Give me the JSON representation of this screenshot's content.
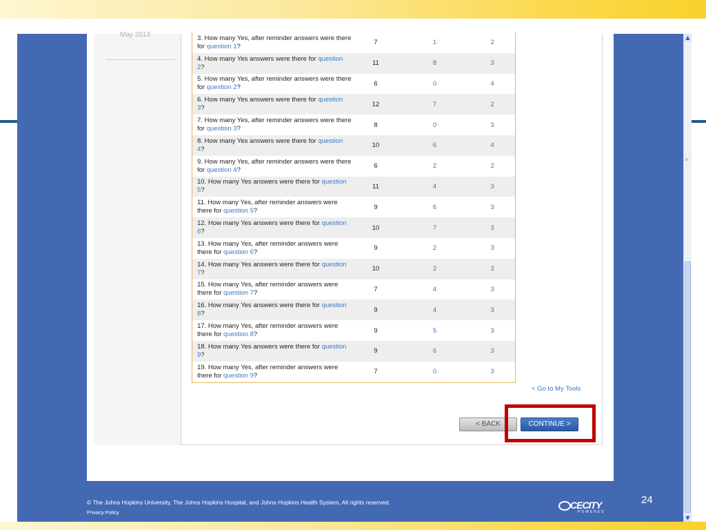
{
  "sidebar": {
    "date": "May 2013"
  },
  "table": {
    "rows": [
      {
        "prefix": "3. How many Yes, after reminder answers were there for ",
        "link": "question 1",
        "suffix": "?",
        "c1": "7",
        "c2": "1",
        "c3": "2"
      },
      {
        "prefix": "4. How many Yes answers were there for ",
        "link": "question 2",
        "suffix": "?",
        "c1": "11",
        "c2": "8",
        "c3": "3"
      },
      {
        "prefix": "5. How many Yes, after reminder answers were there for ",
        "link": "question 2",
        "suffix": "?",
        "c1": "6",
        "c2": "0",
        "c3": "4"
      },
      {
        "prefix": "6. How many Yes answers were there for ",
        "link": "question 3",
        "suffix": "?",
        "c1": "12",
        "c2": "7",
        "c3": "2"
      },
      {
        "prefix": "7. How many Yes, after reminder answers were there for ",
        "link": "question 3",
        "suffix": "?",
        "c1": "8",
        "c2": "0",
        "c3": "3"
      },
      {
        "prefix": "8. How many Yes answers were there for ",
        "link": "question 4",
        "suffix": "?",
        "c1": "10",
        "c2": "6",
        "c3": "4"
      },
      {
        "prefix": "9. How many Yes, after reminder answers were there for ",
        "link": "question 4",
        "suffix": "?",
        "c1": "6",
        "c2": "2",
        "c3": "2"
      },
      {
        "prefix": "10. How many Yes answers were there for ",
        "link": "question 5",
        "suffix": "?",
        "c1": "11",
        "c2": "4",
        "c3": "3"
      },
      {
        "prefix": "11. How many Yes, after reminder answers were there for ",
        "link": "question 5",
        "suffix": "?",
        "c1": "9",
        "c2": "6",
        "c3": "3"
      },
      {
        "prefix": "12. How many Yes answers were there for ",
        "link": "question 6",
        "suffix": "?",
        "c1": "10",
        "c2": "7",
        "c3": "3"
      },
      {
        "prefix": "13. How many Yes, after reminder answers were there for ",
        "link": "question 6",
        "suffix": "?",
        "c1": "9",
        "c2": "2",
        "c3": "3"
      },
      {
        "prefix": "14. How many Yes answers were there for ",
        "link": "question 7",
        "suffix": "?",
        "c1": "10",
        "c2": "2",
        "c3": "3"
      },
      {
        "prefix": "15. How many Yes, after reminder answers were there for ",
        "link": "question 7",
        "suffix": "?",
        "c1": "7",
        "c2": "4",
        "c3": "3"
      },
      {
        "prefix": "16. How many Yes answers were there for ",
        "link": "question 8",
        "suffix": "?",
        "c1": "9",
        "c2": "4",
        "c3": "3"
      },
      {
        "prefix": "17. How many Yes, after reminder answers were there for ",
        "link": "question 8",
        "suffix": "?",
        "c1": "9",
        "c2": "5",
        "c3": "3"
      },
      {
        "prefix": "18. How many Yes answers were there for ",
        "link": "question 9",
        "suffix": "?",
        "c1": "9",
        "c2": "6",
        "c3": "3"
      },
      {
        "prefix": "19. How many Yes, after reminder answers were there for ",
        "link": "question 9",
        "suffix": "?",
        "c1": "7",
        "c2": "0",
        "c3": "3"
      }
    ]
  },
  "nav": {
    "go_to_tools": "< Go to My Tools",
    "back_label": "<  BACK",
    "continue_label": "CONTINUE  >"
  },
  "footer": {
    "copyright": "© The Johns Hopkins University, The Johns Hopkins Hospital, and Johns Hopkins Health System, All rights reserved.",
    "privacy": "Privacy Policy",
    "logo_text": "CECITY",
    "logo_sub": "POWERED",
    "slide_number": "24"
  },
  "colors": {
    "accent_blue": "#4469b3",
    "link_blue": "#3a78c3",
    "highlight_red": "#c00000",
    "table_border": "#e7b25d"
  }
}
